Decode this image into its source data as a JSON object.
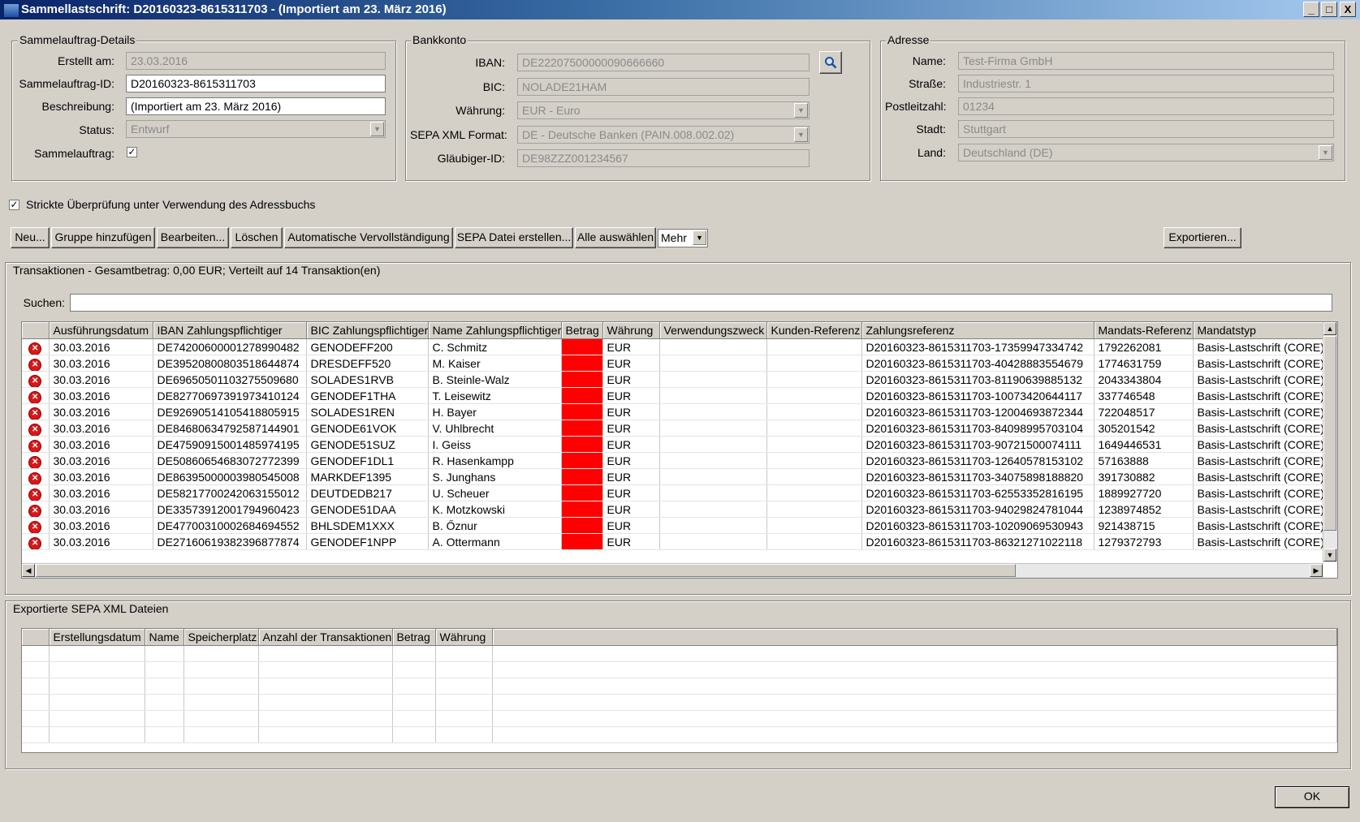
{
  "window": {
    "title": "Sammellastschrift: D20160323-8615311703 - (Importiert am 23. März 2016)",
    "minimize": "_",
    "maximize": "□",
    "close": "X"
  },
  "details": {
    "legend": "Sammelauftrag-Details",
    "created_label": "Erstellt am:",
    "created_value": "23.03.2016",
    "id_label": "Sammelauftrag-ID:",
    "id_value": "D20160323-8615311703",
    "desc_label": "Beschreibung:",
    "desc_value": "(Importiert am 23. März 2016)",
    "status_label": "Status:",
    "status_value": "Entwurf",
    "batch_label": "Sammelauftrag:",
    "batch_checked": "✓"
  },
  "bank": {
    "legend": "Bankkonto",
    "iban_label": "IBAN:",
    "iban_value": "DE22207500000090666660",
    "bic_label": "BIC:",
    "bic_value": "NOLADE21HAM",
    "currency_label": "Währung:",
    "currency_value": "EUR - Euro",
    "format_label": "SEPA XML Format:",
    "format_value": "DE - Deutsche Banken (PAIN.008.002.02)",
    "creditor_label": "Gläubiger-ID:",
    "creditor_value": "DE98ZZZ001234567"
  },
  "address": {
    "legend": "Adresse",
    "name_label": "Name:",
    "name_value": "Test-Firma GmbH",
    "street_label": "Straße:",
    "street_value": "Industriestr. 1",
    "zip_label": "Postleitzahl:",
    "zip_value": "01234",
    "city_label": "Stadt:",
    "city_value": "Stuttgart",
    "country_label": "Land:",
    "country_value": "Deutschland (DE)"
  },
  "strict_check": {
    "checked": "✓",
    "label": "Strickte Überprüfung unter Verwendung des Adressbuchs"
  },
  "toolbar": {
    "new": "Neu...",
    "add_group": "Gruppe hinzufügen",
    "edit": "Bearbeiten...",
    "delete": "Löschen",
    "autocomplete": "Automatische Vervollständigung",
    "create_sepa": "SEPA Datei erstellen...",
    "select_all": "Alle auswählen",
    "more": "Mehr",
    "export": "Exportieren..."
  },
  "transactions": {
    "legend": "Transaktionen - Gesamtbetrag: 0,00 EUR; Verteilt auf 14 Transaktion(en)",
    "search_label": "Suchen:",
    "search_value": "",
    "columns": [
      "",
      "Ausführungsdatum",
      "IBAN Zahlungspflichtiger",
      "BIC Zahlungspflichtiger",
      "Name Zahlungspflichtiger",
      "Betrag",
      "Währung",
      "Verwendungszweck",
      "Kunden-Referenz",
      "Zahlungsreferenz",
      "Mandats-Referenz",
      "Mandatstyp"
    ],
    "rows": [
      [
        "30.03.2016",
        "DE74200600001278990482",
        "GENODEFF200",
        "C. Schmitz",
        "",
        "EUR",
        "",
        "",
        "D20160323-8615311703-17359947334742",
        "1792262081",
        "Basis-Lastschrift (CORE)"
      ],
      [
        "30.03.2016",
        "DE39520800803518644874",
        "DRESDEFF520",
        "M. Kaiser",
        "",
        "EUR",
        "",
        "",
        "D20160323-8615311703-40428883554679",
        "1774631759",
        "Basis-Lastschrift (CORE)"
      ],
      [
        "30.03.2016",
        "DE69650501103275509680",
        "SOLADES1RVB",
        "B. Steinle-Walz",
        "",
        "EUR",
        "",
        "",
        "D20160323-8615311703-81190639885132",
        "2043343804",
        "Basis-Lastschrift (CORE)"
      ],
      [
        "30.03.2016",
        "DE82770697391973410124",
        "GENODEF1THA",
        "T. Leisewitz",
        "",
        "EUR",
        "",
        "",
        "D20160323-8615311703-10073420644117",
        "337746548",
        "Basis-Lastschrift (CORE)"
      ],
      [
        "30.03.2016",
        "DE92690514105418805915",
        "SOLADES1REN",
        "H. Bayer",
        "",
        "EUR",
        "",
        "",
        "D20160323-8615311703-12004693872344",
        "722048517",
        "Basis-Lastschrift (CORE)"
      ],
      [
        "30.03.2016",
        "DE84680634792587144901",
        "GENODE61VOK",
        "V. Uhlbrecht",
        "",
        "EUR",
        "",
        "",
        "D20160323-8615311703-84098995703104",
        "305201542",
        "Basis-Lastschrift (CORE)"
      ],
      [
        "30.03.2016",
        "DE47590915001485974195",
        "GENODE51SUZ",
        "I. Geiss",
        "",
        "EUR",
        "",
        "",
        "D20160323-8615311703-90721500074111",
        "1649446531",
        "Basis-Lastschrift (CORE)"
      ],
      [
        "30.03.2016",
        "DE50860654683072772399",
        "GENODEF1DL1",
        "R. Hasenkampp",
        "",
        "EUR",
        "",
        "",
        "D20160323-8615311703-12640578153102",
        "57163888",
        "Basis-Lastschrift (CORE)"
      ],
      [
        "30.03.2016",
        "DE86395000003980545008",
        "MARKDEF1395",
        "S. Junghans",
        "",
        "EUR",
        "",
        "",
        "D20160323-8615311703-34075898188820",
        "391730882",
        "Basis-Lastschrift (CORE)"
      ],
      [
        "30.03.2016",
        "DE58217700242063155012",
        "DEUTDEDB217",
        "U. Scheuer",
        "",
        "EUR",
        "",
        "",
        "D20160323-8615311703-62553352816195",
        "1889927720",
        "Basis-Lastschrift (CORE)"
      ],
      [
        "30.03.2016",
        "DE33573912001794960423",
        "GENODE51DAA",
        "K. Motzkowski",
        "",
        "EUR",
        "",
        "",
        "D20160323-8615311703-94029824781044",
        "1238974852",
        "Basis-Lastschrift (CORE)"
      ],
      [
        "30.03.2016",
        "DE47700310002684694552",
        "BHLSDEM1XXX",
        "B. Őznur",
        "",
        "EUR",
        "",
        "",
        "D20160323-8615311703-10209069530943",
        "921438715",
        "Basis-Lastschrift (CORE)"
      ],
      [
        "30.03.2016",
        "DE27160619382396877874",
        "GENODEF1NPP",
        "A. Ottermann",
        "",
        "EUR",
        "",
        "",
        "D20160323-8615311703-86321271022118",
        "1279372793",
        "Basis-Lastschrift (CORE)"
      ]
    ],
    "error_glyph": "✕"
  },
  "exported": {
    "legend": "Exportierte SEPA XML Dateien",
    "columns": [
      "",
      "Erstellungsdatum",
      "Name",
      "Speicherplatz",
      "Anzahl der Transaktionen",
      "Betrag",
      "Währung",
      ""
    ]
  },
  "ok_button": "OK",
  "colors": {
    "error_red": "#ff0000",
    "titlebar": "#0a246a"
  },
  "icons": {
    "search": "search-icon",
    "error": "error-icon"
  }
}
